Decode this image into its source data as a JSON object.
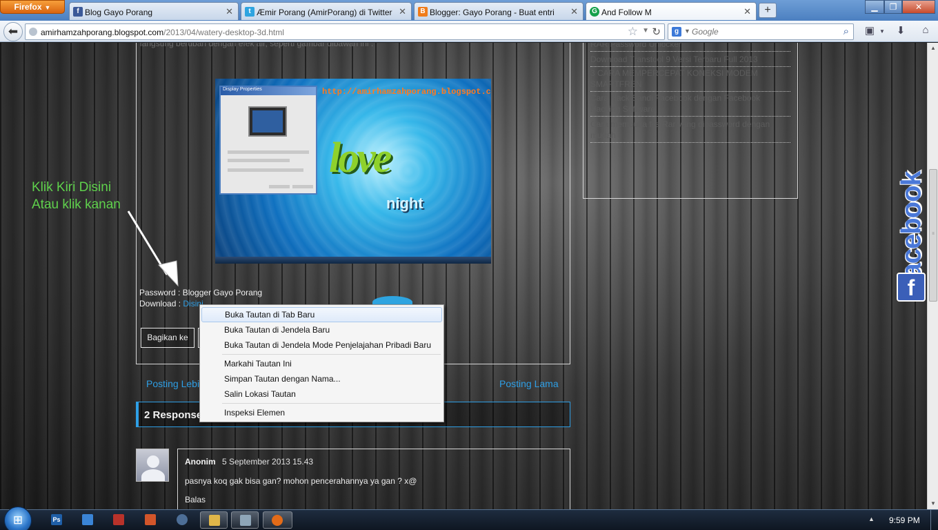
{
  "browser": {
    "app_button": "Firefox",
    "tabs": [
      {
        "title": "Blog Gayo Porang",
        "favicon": "facebook-icon",
        "color": "#3b5998",
        "active": false
      },
      {
        "title": "Æmir Porang (AmirPorang) di Twitter",
        "favicon": "twitter-icon",
        "color": "#2ea4e0",
        "active": false
      },
      {
        "title": "Blogger: Gayo Porang - Buat entri",
        "favicon": "blogger-icon",
        "color": "#f07c1a",
        "active": false
      },
      {
        "title": "And Follow M",
        "favicon": "grammarly-icon",
        "color": "#15a04a",
        "active": true
      }
    ],
    "url_domain": "amirhamzahporang.blogspot.com",
    "url_path": "/2013/04/watery-desktop-3d.html",
    "search_placeholder": "Google",
    "search_engine_label": "g"
  },
  "page": {
    "intro_text": "langsung berubah dengan efek air, seperti gambar dibawah ini .",
    "screenshot_overlay_url": "http://amirhamzahporang.blogspot.com/",
    "screenshot_dialog_title": "Display Properties",
    "screenshot_love": "love",
    "screenshot_night": "night",
    "annotation_line1": "Klik Kiri Disini",
    "annotation_line2": "Atau klik kanan",
    "password_label": "Password :",
    "password_value": "Blogger Gayo Porang",
    "download_label": "Download :",
    "download_link": "Disini",
    "share_button": "Bagikan ke",
    "newer_posts": "Posting Lebih Baru",
    "older_posts": "Posting Lama",
    "responses_title": "2 Responses to \"Watery Desktop 3D\"",
    "comment": {
      "author": "Anonim",
      "date": "5 September 2013 15.43",
      "text": "pasnya koq gak bisa gan? mohon pencerahannya ya gan ? x@",
      "reply": "Balas"
    },
    "sidebar_items": [
      "RAR Password Unlocker",
      "Download Transtool 9 Versi Terbaru Full 2013",
      "3 CARA MEMPERCEPAT KONEKSI MODEM SMARTFREN",
      "Cara Hack Sandi Facebook dengan Facebook Hacking Software",
      "Cara membuka file Rar yang dipassword dengan mudah"
    ],
    "facebook_badge": "facebook",
    "facebook_f": "f"
  },
  "context_menu": {
    "items": [
      {
        "label": "Buka Tautan di Tab Baru",
        "highlighted": true
      },
      {
        "label": "Buka Tautan di Jendela Baru",
        "highlighted": false
      },
      {
        "label": "Buka Tautan di Jendela Mode Penjelajahan Pribadi Baru",
        "highlighted": false
      },
      {
        "separator": true
      },
      {
        "label": "Markahi Tautan Ini",
        "highlighted": false
      },
      {
        "label": "Simpan Tautan dengan Nama...",
        "highlighted": false
      },
      {
        "label": "Salin Lokasi Tautan",
        "highlighted": false
      },
      {
        "separator": true
      },
      {
        "label": "Inspeksi Elemen",
        "highlighted": false
      }
    ]
  },
  "taskbar": {
    "apps": [
      {
        "name": "photoshop-icon",
        "label": "Ps",
        "color": "#1f5fa8",
        "active": false
      },
      {
        "name": "notebook-icon",
        "label": "",
        "color": "#3a84d6",
        "active": false
      },
      {
        "name": "book-icon",
        "label": "",
        "color": "#b8322a",
        "active": false
      },
      {
        "name": "reader-icon",
        "label": "",
        "color": "#d2552a",
        "active": false
      },
      {
        "name": "media-player-icon",
        "label": "",
        "color": "#4d6e96",
        "active": false
      },
      {
        "name": "folder-icon",
        "label": "",
        "color": "#e0b649",
        "active": false
      },
      {
        "name": "notepad-icon",
        "label": "",
        "color": "#8fa6b8",
        "active": false
      },
      {
        "name": "firefox-icon",
        "label": "",
        "color": "#e36b18",
        "active": true
      }
    ],
    "clock": "9:59 PM"
  }
}
